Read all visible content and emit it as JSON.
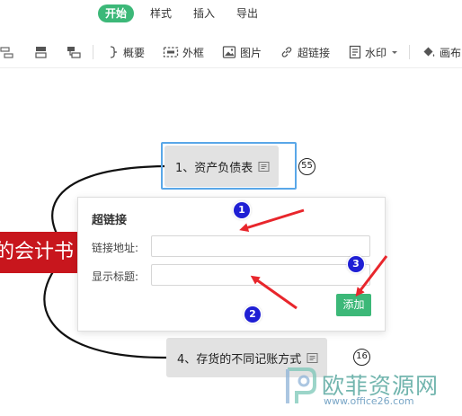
{
  "tabs": [
    {
      "label": "开始",
      "active": true
    },
    {
      "label": "样式",
      "active": false
    },
    {
      "label": "插入",
      "active": false
    },
    {
      "label": "导出",
      "active": false
    }
  ],
  "toolbar": {
    "summary_label": "概要",
    "frame_label": "外框",
    "image_label": "图片",
    "hyperlink_label": "超链接",
    "watermark_label": "水印",
    "canvas_label": "画布"
  },
  "mindmap": {
    "root_label": "的会计书",
    "topic1": {
      "label": "1、资产负债表",
      "count": "55"
    },
    "topic4": {
      "label": "4、存货的不同记账方式",
      "count": "16"
    }
  },
  "hyperlink_popup": {
    "title": "超链接",
    "address_label": "链接地址:",
    "address_value": "",
    "display_label": "显示标题:",
    "display_value": "",
    "add_button": "添加"
  },
  "annotations": {
    "badges": [
      "1",
      "2",
      "3"
    ],
    "arrow_color": "#e8262c",
    "badge_color": "#1f1fd4"
  },
  "watermark": {
    "text": "欧菲资源网",
    "url": "www.office26.com"
  },
  "colors": {
    "accent": "#3cb878",
    "root_node": "#c8161d",
    "selection": "#59a7e8"
  }
}
